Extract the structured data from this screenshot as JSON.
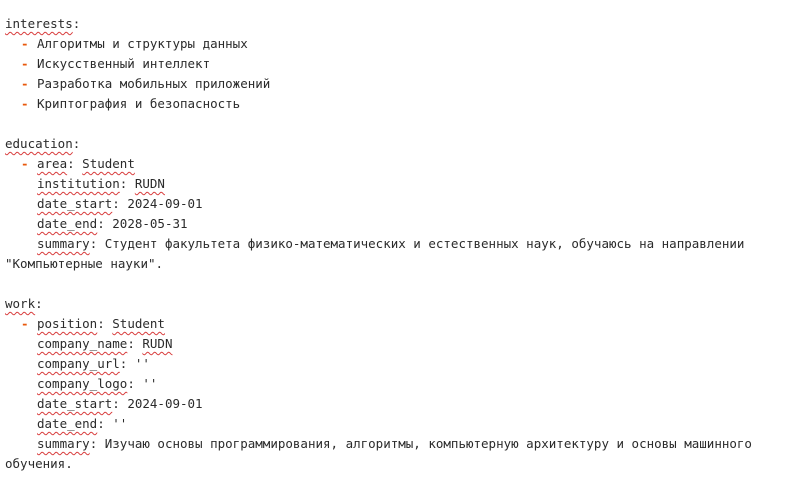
{
  "interests": {
    "key": "interests",
    "items": [
      "Алгоритмы и структуры данных",
      "Искусственный интеллект",
      "Разработка мобильных приложений",
      "Криптография и безопасность"
    ]
  },
  "education": {
    "key": "education",
    "fields": {
      "area_key": "area",
      "area_val": "Student",
      "institution_key": "institution",
      "institution_val": "RUDN",
      "date_start_key": "date_start",
      "date_start_val": "2024-09-01",
      "date_end_key": "date_end",
      "date_end_val": "2028-05-31",
      "summary_key": "summary",
      "summary_val": "Студент факультета физико-математических и естественных наук, обучаюсь на направлении \"Компьютерные науки\"."
    }
  },
  "work": {
    "key": "work",
    "fields": {
      "position_key": "position",
      "position_val": "Student",
      "company_name_key": "company_name",
      "company_name_val": "RUDN",
      "company_url_key": "company_url",
      "company_url_val": "''",
      "company_logo_key": "company_logo",
      "company_logo_val": "''",
      "date_start_key": "date_start",
      "date_start_val": "2024-09-01",
      "date_end_key": "date_end",
      "date_end_val": "''",
      "summary_key": "summary",
      "summary_val": "Изучаю основы программирования, алгоритмы, компьютерную архитектуру и основы машинного обучения."
    }
  },
  "colors": {
    "dash": "#e8590c",
    "spellcheck": "#d83b3b",
    "text": "#2b2b2b"
  }
}
